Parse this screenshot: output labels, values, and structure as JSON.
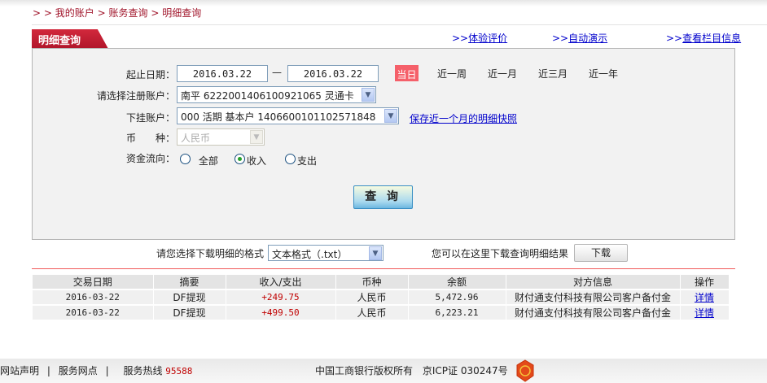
{
  "breadcrumb": {
    "prefix": "> >",
    "items": [
      "我的账户",
      "账务查询",
      "明细查询"
    ],
    "sep": ">"
  },
  "tab": {
    "title": "明细查询"
  },
  "top_links": [
    {
      "prefix": ">>",
      "label": "体验评价"
    },
    {
      "prefix": ">>",
      "label": "自动演示"
    },
    {
      "prefix": ">>",
      "label": "查看栏目信息"
    }
  ],
  "form": {
    "date_label": "起止日期：",
    "start_date": "2016.03.22",
    "dash": "—",
    "end_date": "2016.03.22",
    "quick": [
      "当日",
      "近一周",
      "近一月",
      "近三月",
      "近一年"
    ],
    "account_label": "请选择注册账户：",
    "account_value": "南平 6222001406100921065 灵通卡",
    "sub_account_label": "下挂账户：",
    "sub_account_value": "000 活期 基本户 1406600101102571848",
    "snapshot_link": "保存近一个月的明细快照",
    "currency_label": "币　　种：",
    "currency_value": "人民币",
    "flow_label": "资金流向：",
    "flow_options": [
      "全部",
      "收入",
      "支出"
    ],
    "flow_selected": "收入",
    "query_button": "查 询"
  },
  "download": {
    "label": "请您选择下载明细的格式",
    "format_value": "文本格式（.txt）",
    "hint": "您可以在这里下载查询明细结果",
    "button": "下载"
  },
  "table": {
    "headers": [
      "交易日期",
      "摘要",
      "收入/支出",
      "币种",
      "余额",
      "对方信息",
      "操作"
    ],
    "rows": [
      [
        "2016-03-22",
        "DF提现",
        "+249.75",
        "人民币",
        "5,472.96",
        "财付通支付科技有限公司客户备付金",
        "详情"
      ],
      [
        "2016-03-22",
        "DF提现",
        "+499.50",
        "人民币",
        "6,223.21",
        "财付通支付科技有限公司客户备付金",
        "详情"
      ]
    ]
  },
  "footer": {
    "links": [
      "网站声明",
      "服务网点"
    ],
    "hotline_label": "服务热线",
    "hotline": "95588",
    "copyright": "中国工商银行版权所有",
    "icp": "京ICP证 030247号"
  },
  "colors": {
    "brand_red": "#b8182e",
    "amount_red": "#c00000",
    "link_blue": "#0000cc"
  }
}
